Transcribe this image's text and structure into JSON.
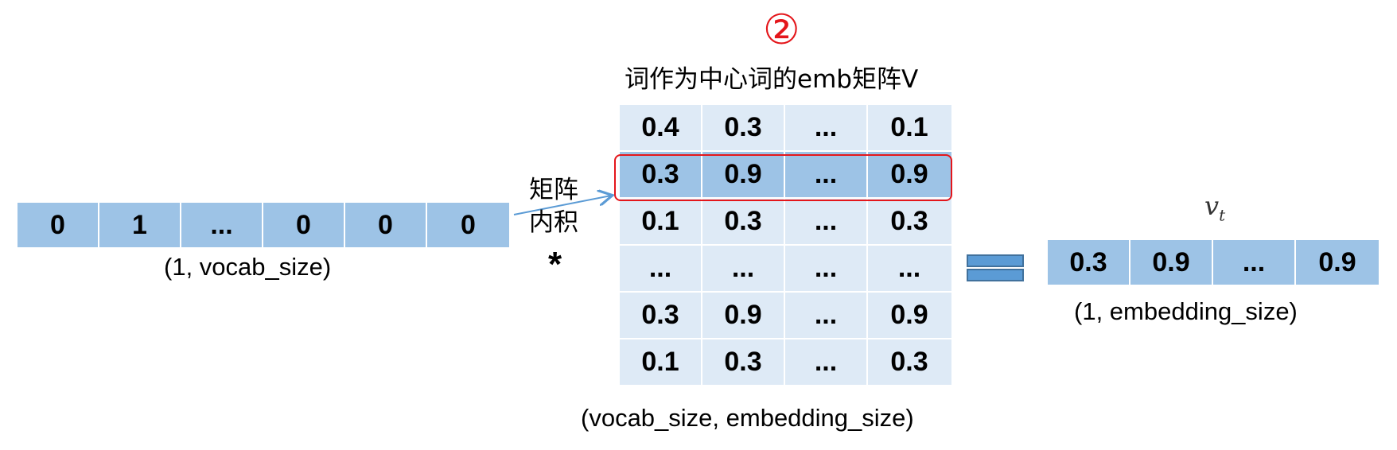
{
  "onehot": {
    "values": [
      "0",
      "1",
      "...",
      "0",
      "0",
      "0"
    ],
    "shape_label": "(1, vocab_size)"
  },
  "operation": {
    "label_line1": "矩阵",
    "label_line2": "内积",
    "symbol": "*"
  },
  "matrix": {
    "step_marker": "②",
    "title": "词作为中心词的emb矩阵V",
    "rows": [
      [
        "0.4",
        "0.3",
        "...",
        "0.1"
      ],
      [
        "0.3",
        "0.9",
        "...",
        "0.9"
      ],
      [
        "0.1",
        "0.3",
        "...",
        "0.3"
      ],
      [
        "...",
        "...",
        "...",
        "..."
      ],
      [
        "0.3",
        "0.9",
        "...",
        "0.9"
      ],
      [
        "0.1",
        "0.3",
        "...",
        "0.3"
      ]
    ],
    "highlighted_row_index": 1,
    "shape_label": "(vocab_size, embedding_size)"
  },
  "result": {
    "name_main": "v",
    "name_sub": "t",
    "values": [
      "0.3",
      "0.9",
      "...",
      "0.9"
    ],
    "shape_label": "(1, embedding_size)"
  },
  "colors": {
    "cell_dark": "#9dc3e6",
    "cell_light": "#deeaf6",
    "highlight_border": "#e4161b",
    "arrow": "#5b9bd5"
  }
}
